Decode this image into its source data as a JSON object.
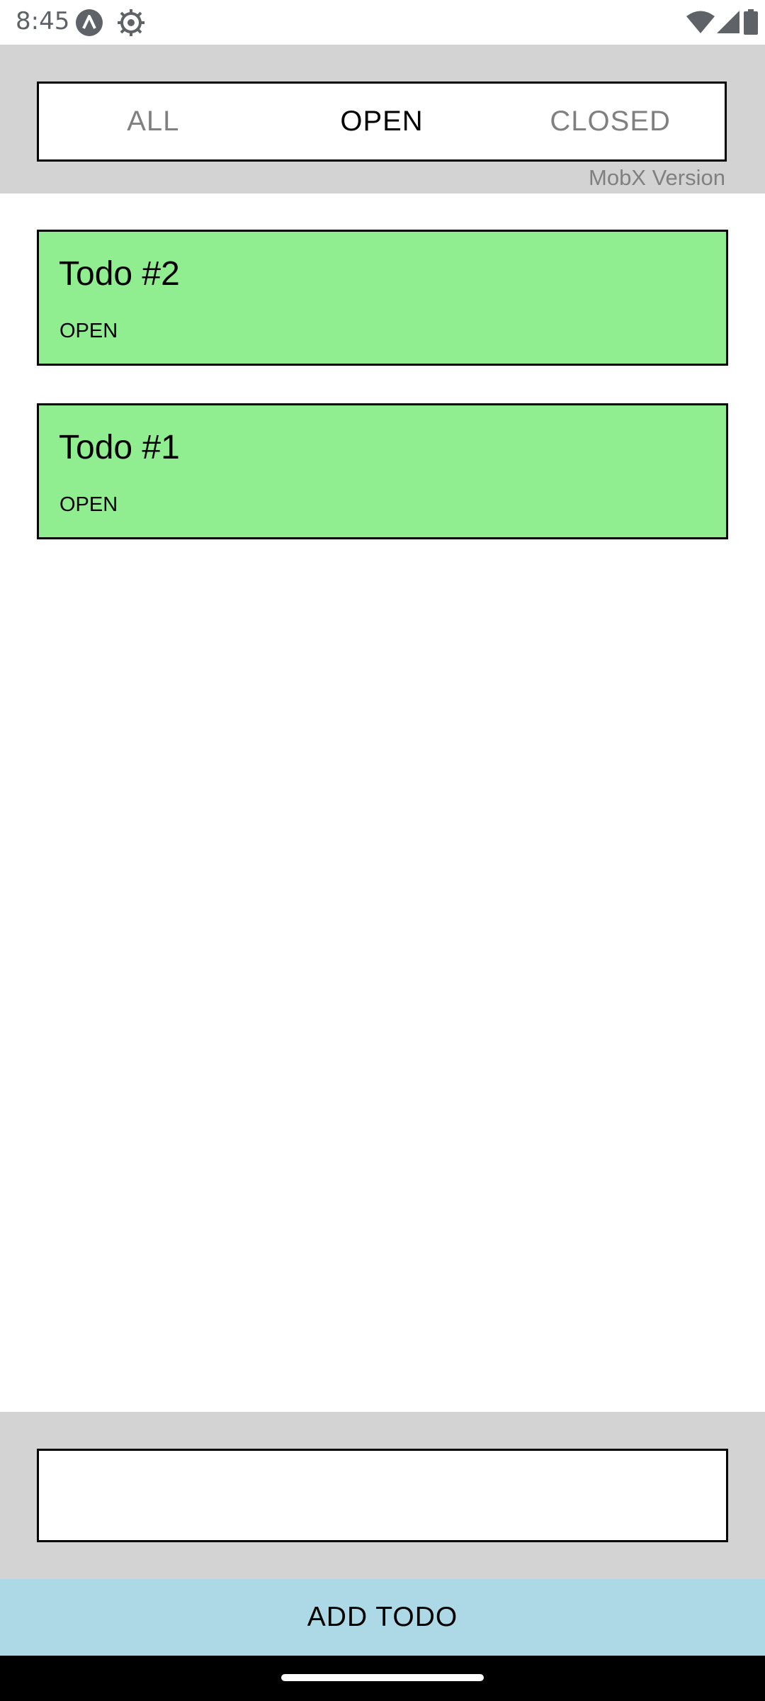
{
  "status_bar": {
    "time": "8:45",
    "icons": [
      "app-icon",
      "gear-icon",
      "wifi-icon",
      "signal-icon",
      "battery-icon"
    ]
  },
  "filter": {
    "tabs": [
      {
        "label": "ALL",
        "active": false
      },
      {
        "label": "OPEN",
        "active": true
      },
      {
        "label": "CLOSED",
        "active": false
      }
    ],
    "version_label": "MobX Version"
  },
  "todos": [
    {
      "title": "Todo #2",
      "status": "OPEN"
    },
    {
      "title": "Todo #1",
      "status": "OPEN"
    }
  ],
  "input": {
    "value": "",
    "placeholder": ""
  },
  "add_button": {
    "label": "ADD TODO"
  },
  "colors": {
    "header_bg": "#d3d3d3",
    "todo_open": "#90ee90",
    "add_button_bg": "#add8e6",
    "inactive_tab": "#808080"
  }
}
